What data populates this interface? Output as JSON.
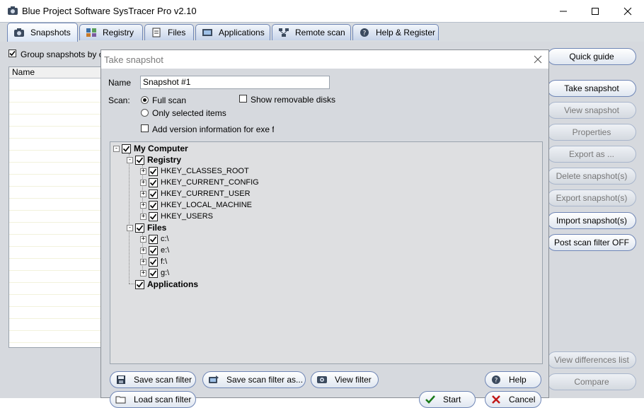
{
  "app": {
    "title": "Blue Project Software SysTracer Pro v2.10"
  },
  "tabs": [
    {
      "label": "Snapshots"
    },
    {
      "label": "Registry"
    },
    {
      "label": "Files"
    },
    {
      "label": "Applications"
    },
    {
      "label": "Remote scan"
    },
    {
      "label": "Help & Register"
    }
  ],
  "main": {
    "group_checkbox_label": "Group snapshots by co",
    "list_header": "Name"
  },
  "right_buttons": [
    {
      "label": "Quick guide"
    },
    {
      "label": "Take snapshot"
    },
    {
      "label": "View snapshot"
    },
    {
      "label": "Properties"
    },
    {
      "label": "Export as ..."
    },
    {
      "label": "Delete snapshot(s)"
    },
    {
      "label": "Export snapshot(s)"
    },
    {
      "label": "Import snapshot(s)"
    },
    {
      "label": "Post scan filter OFF"
    },
    {
      "label": "View differences list"
    },
    {
      "label": "Compare"
    }
  ],
  "dialog": {
    "title": "Take snapshot",
    "name_label": "Name",
    "name_value": "Snapshot #1",
    "scan_label": "Scan:",
    "full_scan": "Full scan",
    "only_selected": "Only selected items",
    "show_removable": "Show removable disks",
    "add_version": "Add version information for exe files",
    "tree": {
      "root": "My Computer",
      "registry": "Registry",
      "registry_items": [
        "HKEY_CLASSES_ROOT",
        "HKEY_CURRENT_CONFIG",
        "HKEY_CURRENT_USER",
        "HKEY_LOCAL_MACHINE",
        "HKEY_USERS"
      ],
      "files": "Files",
      "file_items": [
        "c:\\",
        "e:\\",
        "f:\\",
        "g:\\"
      ],
      "applications": "Applications"
    },
    "buttons": {
      "save_filter": "Save scan filter",
      "save_filter_as": "Save scan filter as...",
      "view_filter": "View filter",
      "help": "Help",
      "load_filter": "Load scan filter",
      "start": "Start",
      "cancel": "Cancel"
    }
  }
}
